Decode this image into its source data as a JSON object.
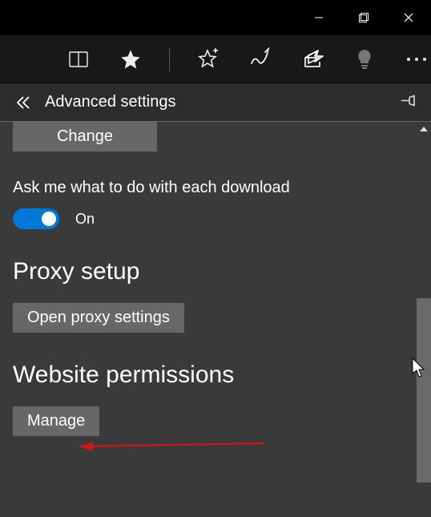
{
  "window": {
    "titlebar": {},
    "toolbar": {
      "icons": [
        "reading-list",
        "favorite",
        "add-favorite",
        "notes",
        "share",
        "tip",
        "more"
      ]
    }
  },
  "header": {
    "title": "Advanced settings"
  },
  "settings": {
    "change_button": "Change",
    "ask_download_label": "Ask me what to do with each download",
    "ask_download_state": "On",
    "proxy_section": "Proxy setup",
    "proxy_button": "Open proxy settings",
    "permissions_section": "Website permissions",
    "permissions_button": "Manage"
  }
}
